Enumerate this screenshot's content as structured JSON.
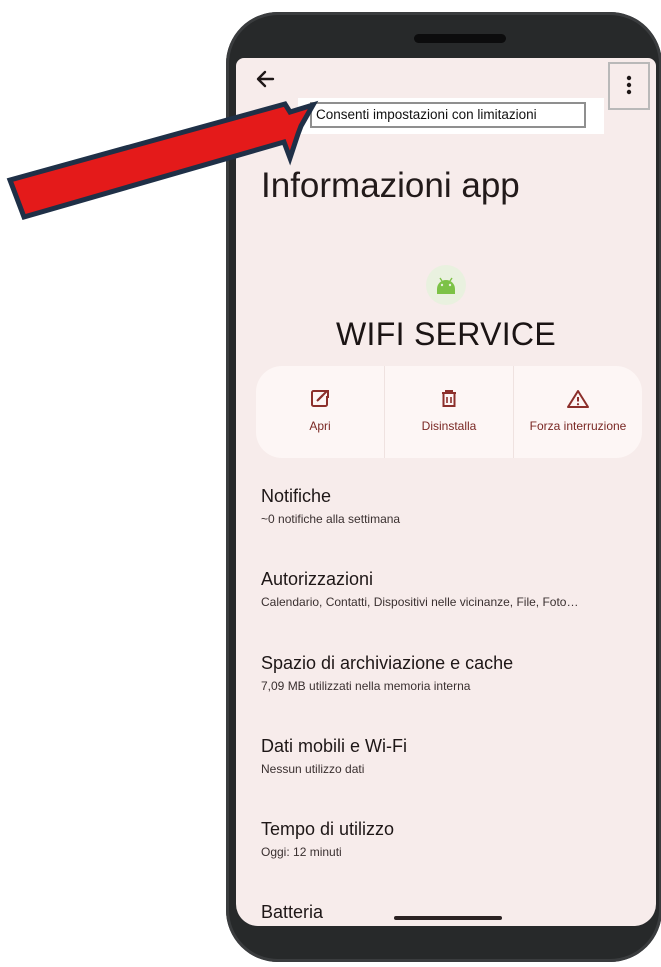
{
  "tooltip": {
    "text": "Consenti impostazioni con limitazioni"
  },
  "page": {
    "title": "Informazioni app"
  },
  "app": {
    "name": "WIFI SERVICE",
    "icon": "android-icon"
  },
  "actions": [
    {
      "label": "Apri",
      "icon": "open-external-icon"
    },
    {
      "label": "Disinstalla",
      "icon": "trash-icon"
    },
    {
      "label": "Forza interruzione",
      "icon": "warning-icon"
    }
  ],
  "settings": [
    {
      "title": "Notifiche",
      "subtitle": "~0 notifiche alla settimana"
    },
    {
      "title": "Autorizzazioni",
      "subtitle": "Calendario, Contatti, Dispositivi nelle vicinanze, File, Foto…"
    },
    {
      "title": "Spazio di archiviazione e cache",
      "subtitle": "7,09 MB utilizzati nella memoria interna"
    },
    {
      "title": "Dati mobili e Wi-Fi",
      "subtitle": "Nessun utilizzo dati"
    },
    {
      "title": "Tempo di utilizzo",
      "subtitle": "Oggi: 12 minuti"
    },
    {
      "title": "Batteria",
      "subtitle": ""
    }
  ],
  "colors": {
    "accent": "#8c2f2b",
    "screen_bg": "#f7eceb",
    "annotation_arrow": "#e41a1a"
  }
}
